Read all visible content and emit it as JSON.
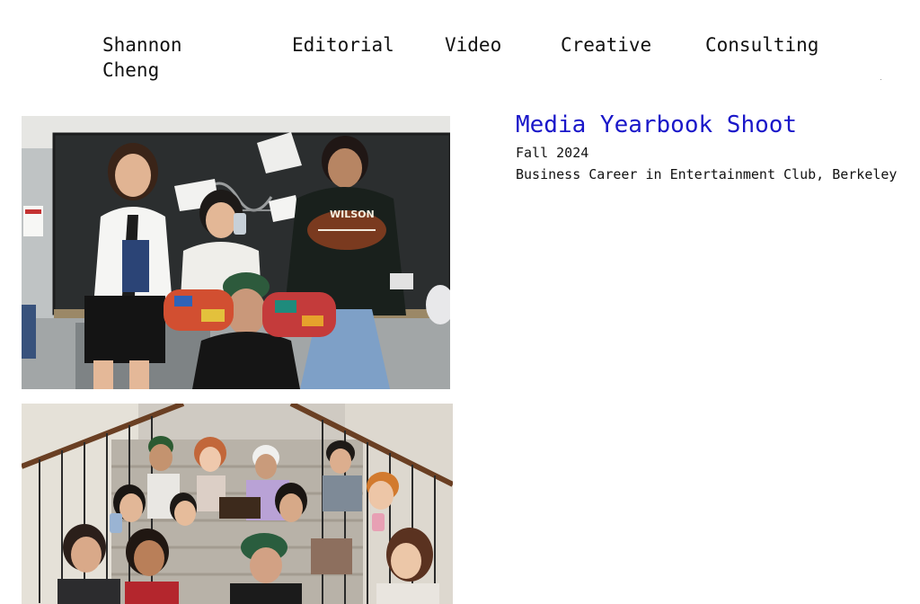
{
  "nav": {
    "brand": "Shannon Cheng",
    "items": [
      {
        "label": "Editorial"
      },
      {
        "label": "Video"
      },
      {
        "label": "Creative"
      },
      {
        "label": "Consulting"
      }
    ]
  },
  "project": {
    "title": "Media Yearbook Shoot",
    "season": "Fall 2024",
    "client": "Business Career in Entertainment Club, Berkeley"
  },
  "photos": [
    {
      "subject": "group-at-chalkboard-photo"
    },
    {
      "subject": "group-on-staircase-photo"
    }
  ],
  "colors": {
    "accent": "#1a17c9",
    "text": "#111111",
    "background": "#ffffff"
  }
}
